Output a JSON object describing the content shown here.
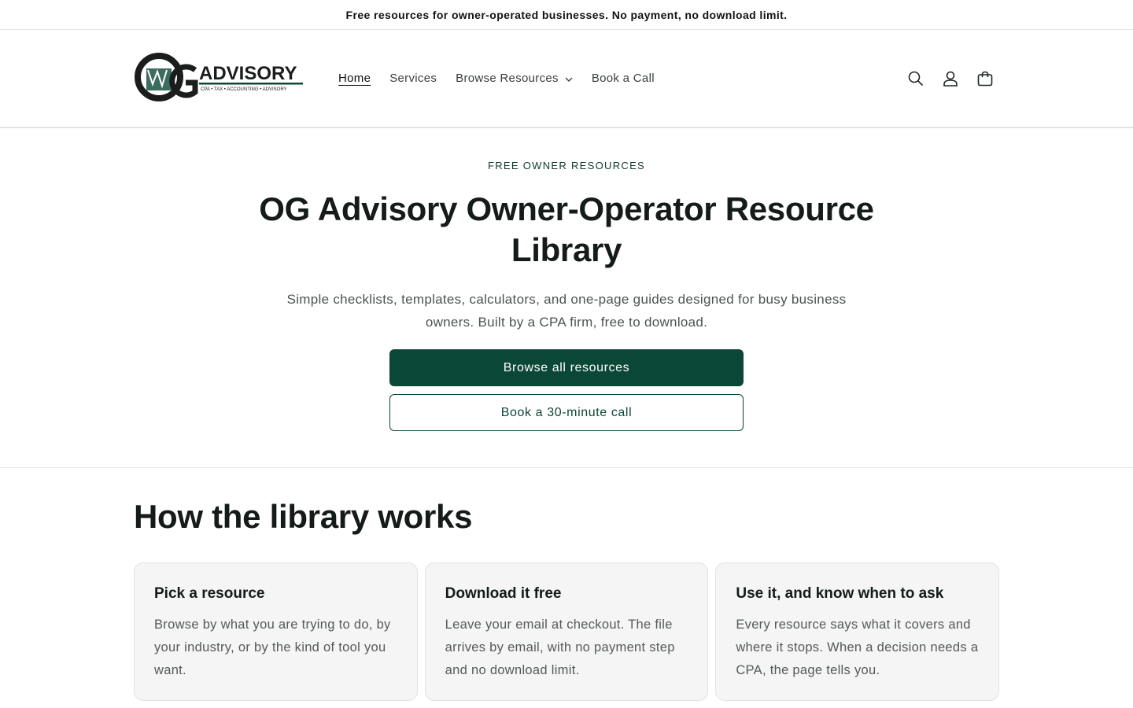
{
  "announcement": "Free resources for owner-operated businesses. No payment, no download limit.",
  "logo": {
    "wordmark": "ADVISORY",
    "monogram": "OG",
    "tagline": "CPA • TAX • ACCOUNTING • ADVISORY"
  },
  "nav": {
    "home": "Home",
    "services": "Services",
    "browse": "Browse Resources",
    "book": "Book a Call"
  },
  "hero": {
    "eyebrow": "FREE OWNER RESOURCES",
    "title": "OG Advisory Owner-Operator Resource Library",
    "subtitle": "Simple checklists, templates, calculators, and one-page guides designed for busy business owners. Built by a CPA firm, free to download.",
    "primary_button": "Browse all resources",
    "secondary_button": "Book a 30-minute call"
  },
  "how": {
    "heading": "How the library works",
    "cards": [
      {
        "title": "Pick a resource",
        "body": "Browse by what you are trying to do, by your industry, or by the kind of tool you want."
      },
      {
        "title": "Download it free",
        "body": "Leave your email at checkout. The file arrives by email, with no payment step and no download limit."
      },
      {
        "title": "Use it, and know when to ask",
        "body": "Every resource says what it covers and where it stops. When a decision needs a CPA, the page tells you."
      }
    ]
  },
  "icons": [
    "search-icon",
    "account-icon",
    "cart-icon",
    "chevron-down-icon"
  ],
  "colors": {
    "brand": "#0b4737",
    "card_bg": "#f4f5f4"
  }
}
